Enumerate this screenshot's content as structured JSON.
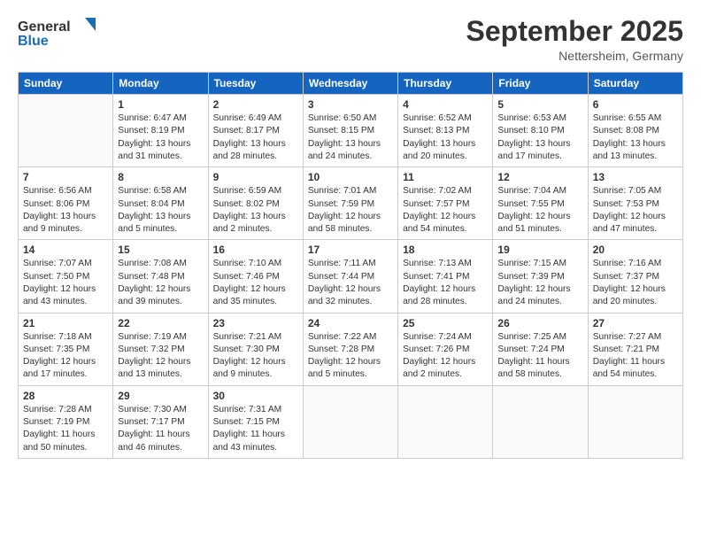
{
  "header": {
    "logo_line1": "General",
    "logo_line2": "Blue",
    "month_title": "September 2025",
    "subtitle": "Nettersheim, Germany"
  },
  "days_of_week": [
    "Sunday",
    "Monday",
    "Tuesday",
    "Wednesday",
    "Thursday",
    "Friday",
    "Saturday"
  ],
  "weeks": [
    [
      {
        "day": "",
        "info": ""
      },
      {
        "day": "1",
        "info": "Sunrise: 6:47 AM\nSunset: 8:19 PM\nDaylight: 13 hours\nand 31 minutes."
      },
      {
        "day": "2",
        "info": "Sunrise: 6:49 AM\nSunset: 8:17 PM\nDaylight: 13 hours\nand 28 minutes."
      },
      {
        "day": "3",
        "info": "Sunrise: 6:50 AM\nSunset: 8:15 PM\nDaylight: 13 hours\nand 24 minutes."
      },
      {
        "day": "4",
        "info": "Sunrise: 6:52 AM\nSunset: 8:13 PM\nDaylight: 13 hours\nand 20 minutes."
      },
      {
        "day": "5",
        "info": "Sunrise: 6:53 AM\nSunset: 8:10 PM\nDaylight: 13 hours\nand 17 minutes."
      },
      {
        "day": "6",
        "info": "Sunrise: 6:55 AM\nSunset: 8:08 PM\nDaylight: 13 hours\nand 13 minutes."
      }
    ],
    [
      {
        "day": "7",
        "info": "Sunrise: 6:56 AM\nSunset: 8:06 PM\nDaylight: 13 hours\nand 9 minutes."
      },
      {
        "day": "8",
        "info": "Sunrise: 6:58 AM\nSunset: 8:04 PM\nDaylight: 13 hours\nand 5 minutes."
      },
      {
        "day": "9",
        "info": "Sunrise: 6:59 AM\nSunset: 8:02 PM\nDaylight: 13 hours\nand 2 minutes."
      },
      {
        "day": "10",
        "info": "Sunrise: 7:01 AM\nSunset: 7:59 PM\nDaylight: 12 hours\nand 58 minutes."
      },
      {
        "day": "11",
        "info": "Sunrise: 7:02 AM\nSunset: 7:57 PM\nDaylight: 12 hours\nand 54 minutes."
      },
      {
        "day": "12",
        "info": "Sunrise: 7:04 AM\nSunset: 7:55 PM\nDaylight: 12 hours\nand 51 minutes."
      },
      {
        "day": "13",
        "info": "Sunrise: 7:05 AM\nSunset: 7:53 PM\nDaylight: 12 hours\nand 47 minutes."
      }
    ],
    [
      {
        "day": "14",
        "info": "Sunrise: 7:07 AM\nSunset: 7:50 PM\nDaylight: 12 hours\nand 43 minutes."
      },
      {
        "day": "15",
        "info": "Sunrise: 7:08 AM\nSunset: 7:48 PM\nDaylight: 12 hours\nand 39 minutes."
      },
      {
        "day": "16",
        "info": "Sunrise: 7:10 AM\nSunset: 7:46 PM\nDaylight: 12 hours\nand 35 minutes."
      },
      {
        "day": "17",
        "info": "Sunrise: 7:11 AM\nSunset: 7:44 PM\nDaylight: 12 hours\nand 32 minutes."
      },
      {
        "day": "18",
        "info": "Sunrise: 7:13 AM\nSunset: 7:41 PM\nDaylight: 12 hours\nand 28 minutes."
      },
      {
        "day": "19",
        "info": "Sunrise: 7:15 AM\nSunset: 7:39 PM\nDaylight: 12 hours\nand 24 minutes."
      },
      {
        "day": "20",
        "info": "Sunrise: 7:16 AM\nSunset: 7:37 PM\nDaylight: 12 hours\nand 20 minutes."
      }
    ],
    [
      {
        "day": "21",
        "info": "Sunrise: 7:18 AM\nSunset: 7:35 PM\nDaylight: 12 hours\nand 17 minutes."
      },
      {
        "day": "22",
        "info": "Sunrise: 7:19 AM\nSunset: 7:32 PM\nDaylight: 12 hours\nand 13 minutes."
      },
      {
        "day": "23",
        "info": "Sunrise: 7:21 AM\nSunset: 7:30 PM\nDaylight: 12 hours\nand 9 minutes."
      },
      {
        "day": "24",
        "info": "Sunrise: 7:22 AM\nSunset: 7:28 PM\nDaylight: 12 hours\nand 5 minutes."
      },
      {
        "day": "25",
        "info": "Sunrise: 7:24 AM\nSunset: 7:26 PM\nDaylight: 12 hours\nand 2 minutes."
      },
      {
        "day": "26",
        "info": "Sunrise: 7:25 AM\nSunset: 7:24 PM\nDaylight: 11 hours\nand 58 minutes."
      },
      {
        "day": "27",
        "info": "Sunrise: 7:27 AM\nSunset: 7:21 PM\nDaylight: 11 hours\nand 54 minutes."
      }
    ],
    [
      {
        "day": "28",
        "info": "Sunrise: 7:28 AM\nSunset: 7:19 PM\nDaylight: 11 hours\nand 50 minutes."
      },
      {
        "day": "29",
        "info": "Sunrise: 7:30 AM\nSunset: 7:17 PM\nDaylight: 11 hours\nand 46 minutes."
      },
      {
        "day": "30",
        "info": "Sunrise: 7:31 AM\nSunset: 7:15 PM\nDaylight: 11 hours\nand 43 minutes."
      },
      {
        "day": "",
        "info": ""
      },
      {
        "day": "",
        "info": ""
      },
      {
        "day": "",
        "info": ""
      },
      {
        "day": "",
        "info": ""
      }
    ]
  ]
}
